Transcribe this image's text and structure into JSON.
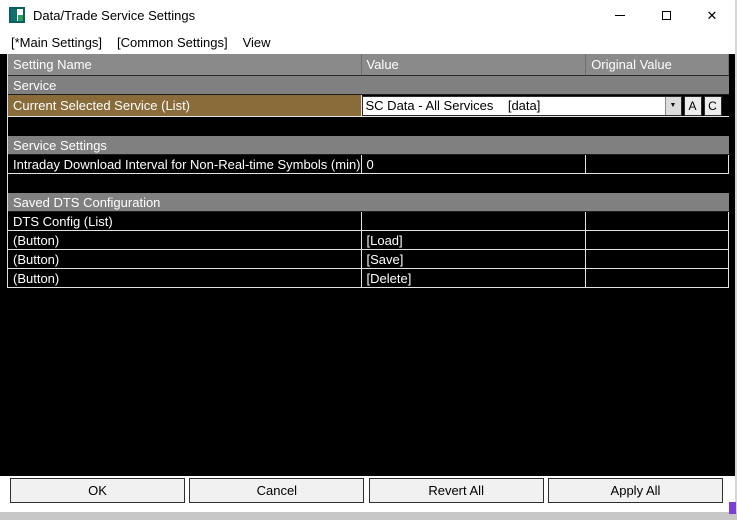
{
  "window": {
    "title": "Data/Trade Service Settings"
  },
  "icons": {
    "close": "✕",
    "dropdown_arrow": "▼"
  },
  "menu": {
    "items": [
      "[*Main Settings]",
      "[Common Settings]",
      "View"
    ]
  },
  "grid": {
    "columns": [
      "Setting Name",
      "Value",
      "Original Value"
    ],
    "rows": [
      {
        "type": "section",
        "label": "Service"
      },
      {
        "type": "setting",
        "name": "Current Selected Service (List)",
        "value": "SC Data - All Services    [data]",
        "control": "dropdown",
        "buttons": [
          "A",
          "C"
        ],
        "selected": true
      },
      {
        "type": "spacer"
      },
      {
        "type": "section",
        "label": "Service Settings"
      },
      {
        "type": "setting",
        "name": "Intraday Download Interval for Non-Real-time Symbols (min)",
        "value": "0"
      },
      {
        "type": "spacer"
      },
      {
        "type": "section",
        "label": "Saved DTS Configuration"
      },
      {
        "type": "setting",
        "name": "DTS Config (List)",
        "value": ""
      },
      {
        "type": "setting",
        "name": "(Button)",
        "value": "[Load]"
      },
      {
        "type": "setting",
        "name": "(Button)",
        "value": "[Save]"
      },
      {
        "type": "setting",
        "name": "(Button)",
        "value": "[Delete]"
      }
    ]
  },
  "footer": {
    "buttons": [
      "OK",
      "Cancel",
      "Revert All",
      "Apply All"
    ]
  },
  "colors": {
    "selected_row": "#8a6c3b",
    "section_header_bg": "#808080",
    "column_header_bg": "#8a8a8a",
    "grid_bg": "#000000",
    "grid_text": "#ffffff"
  }
}
